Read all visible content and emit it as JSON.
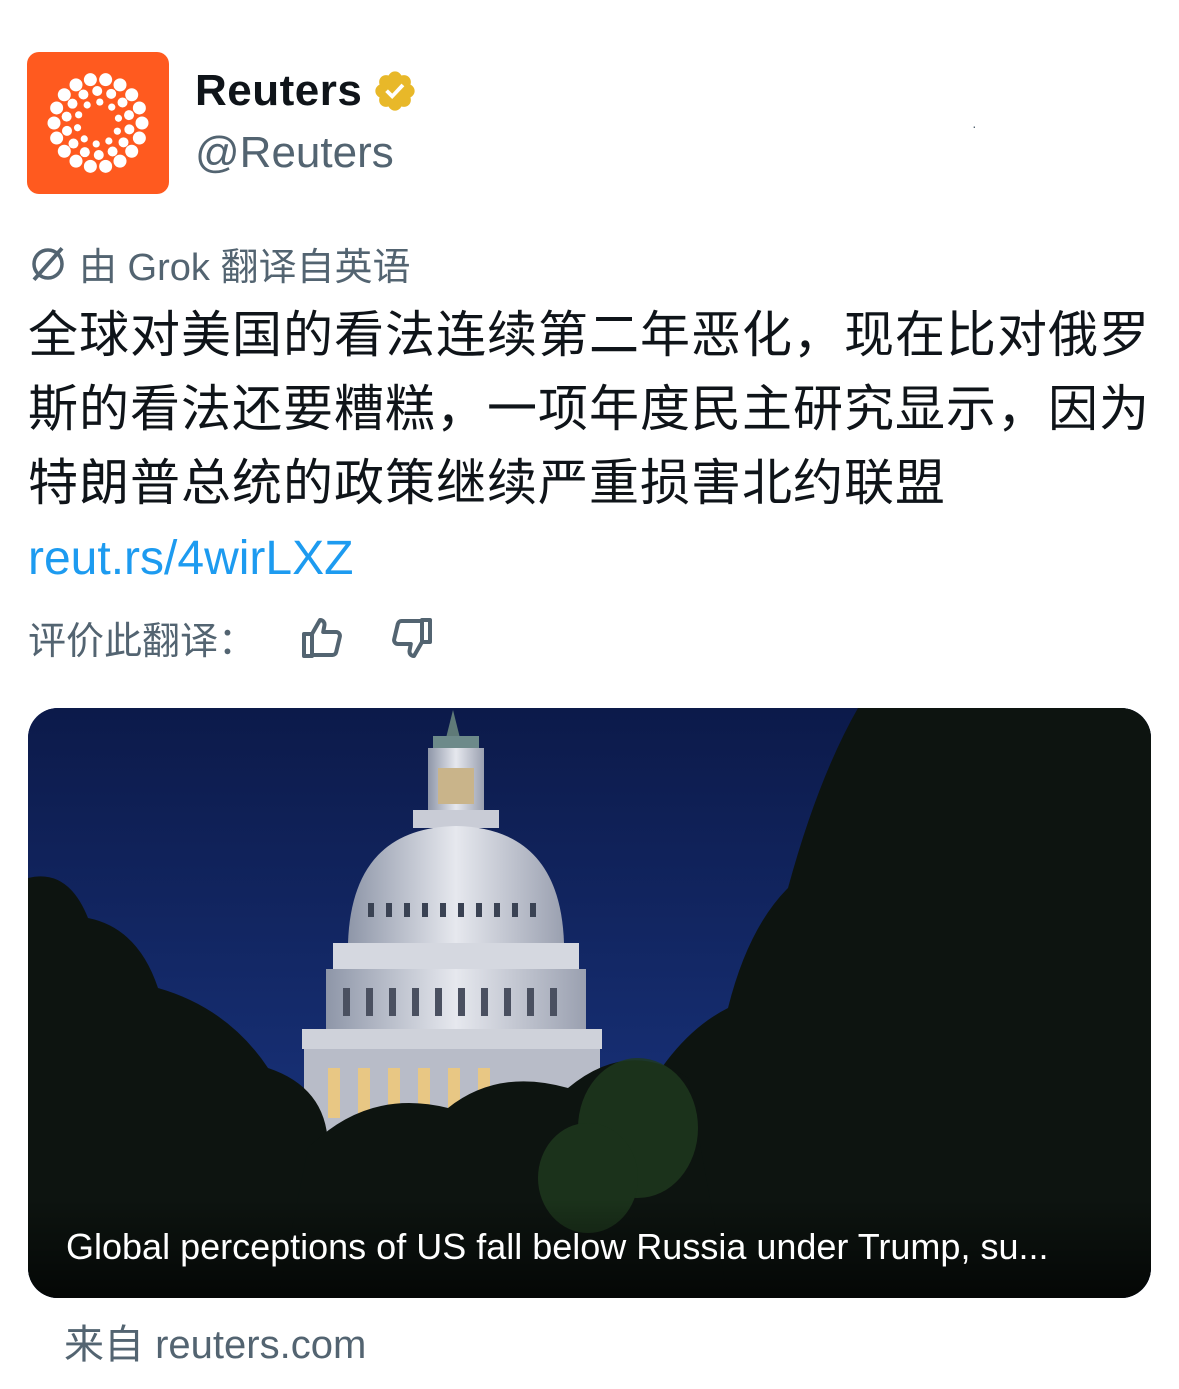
{
  "account": {
    "display_name": "Reuters",
    "handle": "@Reuters",
    "avatar_color": "#ff5a1f",
    "verified_badge_color": "#e8b829",
    "avatar_icon": "reuters-logo-icon"
  },
  "translation": {
    "note": "由 Grok 翻译自英语",
    "icon": "translate-icon"
  },
  "tweet": {
    "text": "全球对美国的看法连续第二年恶化，现在比对俄罗斯的看法还要糟糕，一项年度民主研究显示，因为特朗普总统的政策继续严重损害北约联盟",
    "link": "reut.rs/4wirLXZ",
    "link_color": "#1d9bf0"
  },
  "rate": {
    "label": "评价此翻译：",
    "thumbs_up_icon": "thumbs-up-icon",
    "thumbs_down_icon": "thumbs-down-icon"
  },
  "card": {
    "title": "Global perceptions of US fall below Russia under Trump, su...",
    "image": "capitol-dome-at-night"
  },
  "source": {
    "text": "来自 reuters.com"
  }
}
